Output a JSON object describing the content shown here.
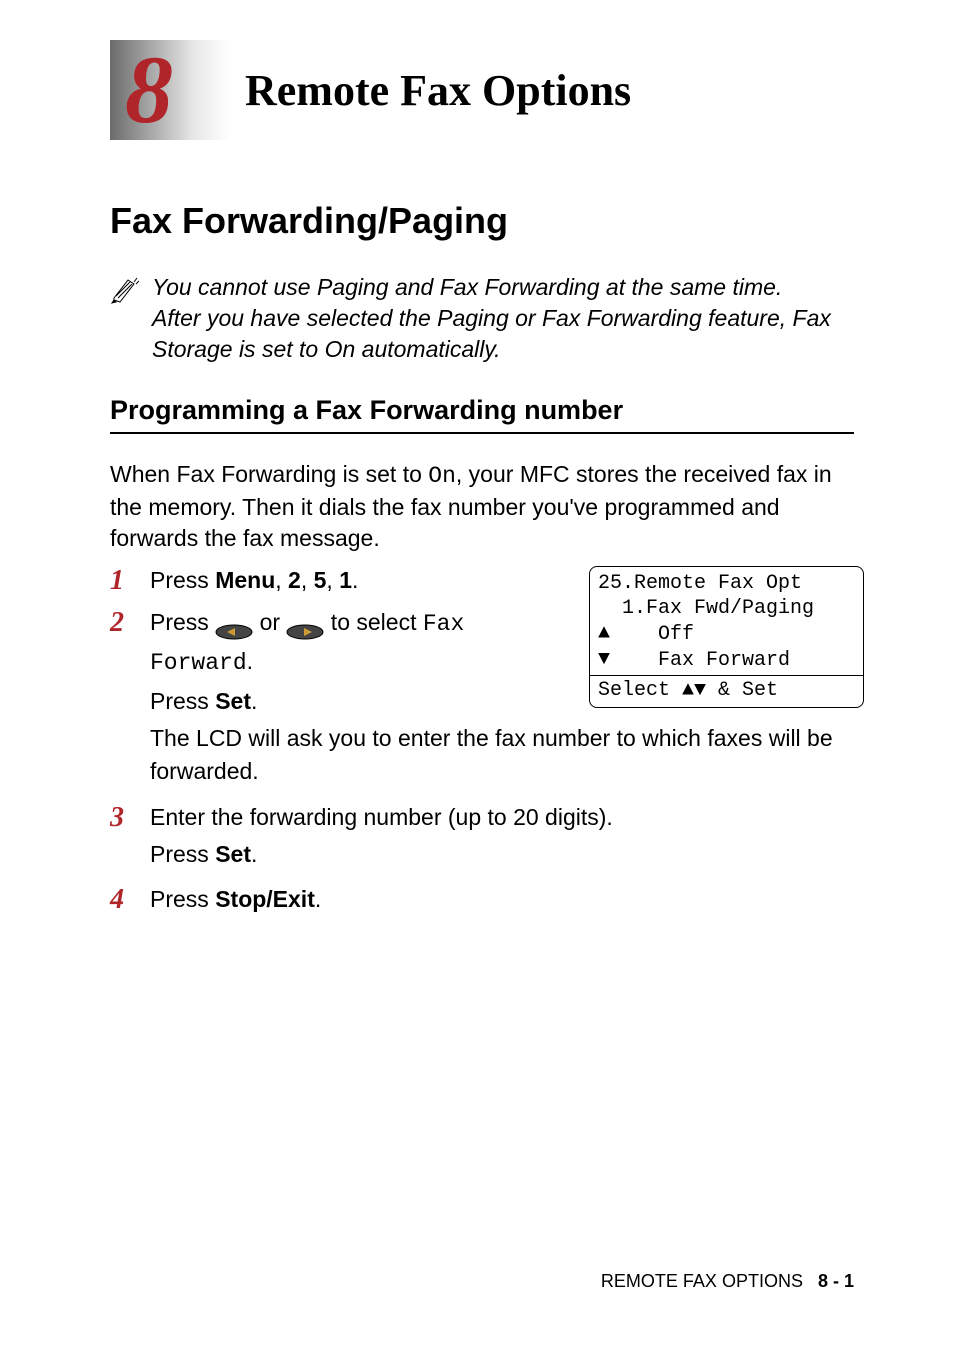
{
  "chapter": {
    "number": "8",
    "title": "Remote Fax Options"
  },
  "section": {
    "title": "Fax Forwarding/Paging"
  },
  "note": {
    "line1": "You cannot use Paging and Fax Forwarding at the same time.",
    "line2": "After you have selected the Paging or Fax Forwarding feature, Fax Storage is set to On automatically."
  },
  "subsection": {
    "title": "Programming a Fax Forwarding number"
  },
  "intro": {
    "pre": "When Fax Forwarding is set to ",
    "on": "On",
    "post": ", your MFC stores the received fax in the memory. Then it dials the fax number you've programmed and forwards the fax message."
  },
  "steps": {
    "s1": {
      "num": "1",
      "press": "Press ",
      "menu": "Menu",
      "comma1": ", ",
      "n2": "2",
      "comma2": ", ",
      "n5": "5",
      "comma3": ", ",
      "n1": "1",
      "period": "."
    },
    "s2": {
      "num": "2",
      "press": "Press ",
      "or": " or ",
      "toselect": " to select ",
      "fax": "Fax",
      "forward": "Forward",
      "period": ".",
      "presssetpre": "Press ",
      "set": "Set",
      "postperiod": ".",
      "lcd": "The LCD will ask you to enter the fax number to which faxes will be forwarded."
    },
    "s3": {
      "num": "3",
      "line1": "Enter the forwarding number (up to 20 digits).",
      "presssetpre": "Press ",
      "set": "Set",
      "postperiod": "."
    },
    "s4": {
      "num": "4",
      "press": "Press ",
      "stopexit": "Stop/Exit",
      "period": "."
    }
  },
  "display": {
    "l1": "25.Remote Fax Opt",
    "l2": "  1.Fax Fwd/Paging",
    "l3_opt": "    Off",
    "l4_opt": "    Fax Forward",
    "select_pre": "Select ",
    "select_post": " & Set"
  },
  "footer": {
    "label": "REMOTE FAX OPTIONS",
    "page": "8 - 1"
  }
}
